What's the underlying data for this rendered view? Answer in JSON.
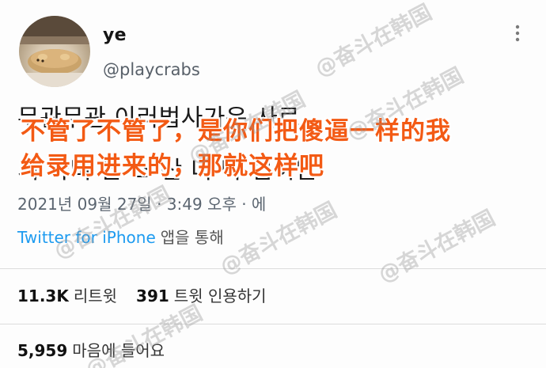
{
  "profile": {
    "display_name": "ye",
    "handle": "@playcrabs",
    "avatar_icon": "bread-loaf-avatar"
  },
  "tweet": {
    "line1": "무관무관 이러법사가은 사르",
    "line2": "서 다비 안 소 산 니 다 렴이만"
  },
  "overlay_caption": {
    "line1": "不管了不管了，是你们把傻逼一样的我",
    "line2": "给录用进来的，那就这样吧",
    "color": "#f35a14"
  },
  "meta": {
    "timestamp": "2021년 09월 27일 · 3:49 오후 · 에",
    "source_app": "Twitter for iPhone",
    "source_suffix": "앱을 통해"
  },
  "stats": {
    "retweets_count": "11.3K",
    "retweets_label": "리트윗",
    "quotes_count": "391",
    "quotes_label": "트윗 인용하기",
    "likes_count": "5,959",
    "likes_label": "마음에 들어요"
  },
  "watermark": {
    "text": "@奋斗在韩国"
  },
  "colors": {
    "link_blue": "#1d9bf0",
    "handle_gray": "#586069"
  }
}
